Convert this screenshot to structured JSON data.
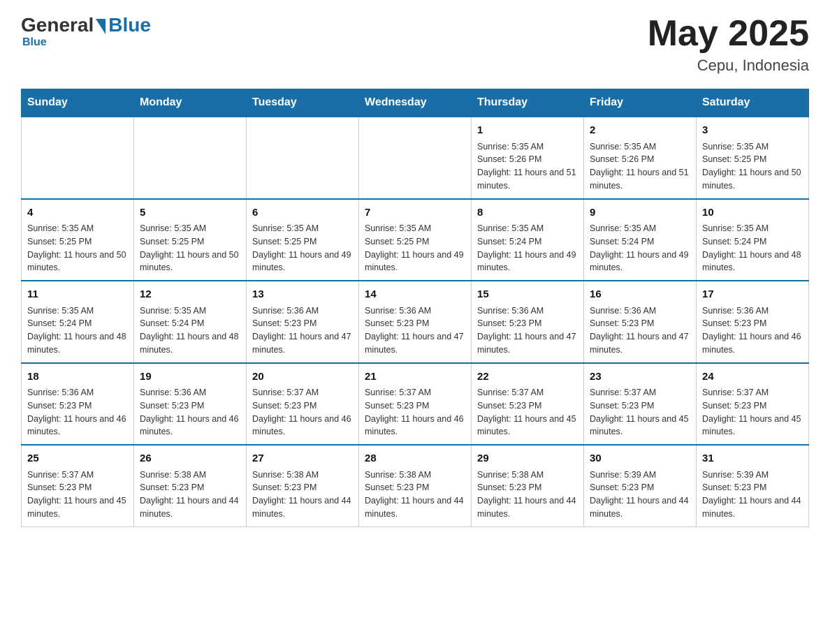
{
  "logo": {
    "general": "General",
    "blue": "Blue",
    "tagline": "Blue"
  },
  "title": {
    "month_year": "May 2025",
    "location": "Cepu, Indonesia"
  },
  "days_of_week": [
    "Sunday",
    "Monday",
    "Tuesday",
    "Wednesday",
    "Thursday",
    "Friday",
    "Saturday"
  ],
  "weeks": [
    [
      {
        "day": "",
        "sunrise": "",
        "sunset": "",
        "daylight": ""
      },
      {
        "day": "",
        "sunrise": "",
        "sunset": "",
        "daylight": ""
      },
      {
        "day": "",
        "sunrise": "",
        "sunset": "",
        "daylight": ""
      },
      {
        "day": "",
        "sunrise": "",
        "sunset": "",
        "daylight": ""
      },
      {
        "day": "1",
        "sunrise": "Sunrise: 5:35 AM",
        "sunset": "Sunset: 5:26 PM",
        "daylight": "Daylight: 11 hours and 51 minutes."
      },
      {
        "day": "2",
        "sunrise": "Sunrise: 5:35 AM",
        "sunset": "Sunset: 5:26 PM",
        "daylight": "Daylight: 11 hours and 51 minutes."
      },
      {
        "day": "3",
        "sunrise": "Sunrise: 5:35 AM",
        "sunset": "Sunset: 5:25 PM",
        "daylight": "Daylight: 11 hours and 50 minutes."
      }
    ],
    [
      {
        "day": "4",
        "sunrise": "Sunrise: 5:35 AM",
        "sunset": "Sunset: 5:25 PM",
        "daylight": "Daylight: 11 hours and 50 minutes."
      },
      {
        "day": "5",
        "sunrise": "Sunrise: 5:35 AM",
        "sunset": "Sunset: 5:25 PM",
        "daylight": "Daylight: 11 hours and 50 minutes."
      },
      {
        "day": "6",
        "sunrise": "Sunrise: 5:35 AM",
        "sunset": "Sunset: 5:25 PM",
        "daylight": "Daylight: 11 hours and 49 minutes."
      },
      {
        "day": "7",
        "sunrise": "Sunrise: 5:35 AM",
        "sunset": "Sunset: 5:25 PM",
        "daylight": "Daylight: 11 hours and 49 minutes."
      },
      {
        "day": "8",
        "sunrise": "Sunrise: 5:35 AM",
        "sunset": "Sunset: 5:24 PM",
        "daylight": "Daylight: 11 hours and 49 minutes."
      },
      {
        "day": "9",
        "sunrise": "Sunrise: 5:35 AM",
        "sunset": "Sunset: 5:24 PM",
        "daylight": "Daylight: 11 hours and 49 minutes."
      },
      {
        "day": "10",
        "sunrise": "Sunrise: 5:35 AM",
        "sunset": "Sunset: 5:24 PM",
        "daylight": "Daylight: 11 hours and 48 minutes."
      }
    ],
    [
      {
        "day": "11",
        "sunrise": "Sunrise: 5:35 AM",
        "sunset": "Sunset: 5:24 PM",
        "daylight": "Daylight: 11 hours and 48 minutes."
      },
      {
        "day": "12",
        "sunrise": "Sunrise: 5:35 AM",
        "sunset": "Sunset: 5:24 PM",
        "daylight": "Daylight: 11 hours and 48 minutes."
      },
      {
        "day": "13",
        "sunrise": "Sunrise: 5:36 AM",
        "sunset": "Sunset: 5:23 PM",
        "daylight": "Daylight: 11 hours and 47 minutes."
      },
      {
        "day": "14",
        "sunrise": "Sunrise: 5:36 AM",
        "sunset": "Sunset: 5:23 PM",
        "daylight": "Daylight: 11 hours and 47 minutes."
      },
      {
        "day": "15",
        "sunrise": "Sunrise: 5:36 AM",
        "sunset": "Sunset: 5:23 PM",
        "daylight": "Daylight: 11 hours and 47 minutes."
      },
      {
        "day": "16",
        "sunrise": "Sunrise: 5:36 AM",
        "sunset": "Sunset: 5:23 PM",
        "daylight": "Daylight: 11 hours and 47 minutes."
      },
      {
        "day": "17",
        "sunrise": "Sunrise: 5:36 AM",
        "sunset": "Sunset: 5:23 PM",
        "daylight": "Daylight: 11 hours and 46 minutes."
      }
    ],
    [
      {
        "day": "18",
        "sunrise": "Sunrise: 5:36 AM",
        "sunset": "Sunset: 5:23 PM",
        "daylight": "Daylight: 11 hours and 46 minutes."
      },
      {
        "day": "19",
        "sunrise": "Sunrise: 5:36 AM",
        "sunset": "Sunset: 5:23 PM",
        "daylight": "Daylight: 11 hours and 46 minutes."
      },
      {
        "day": "20",
        "sunrise": "Sunrise: 5:37 AM",
        "sunset": "Sunset: 5:23 PM",
        "daylight": "Daylight: 11 hours and 46 minutes."
      },
      {
        "day": "21",
        "sunrise": "Sunrise: 5:37 AM",
        "sunset": "Sunset: 5:23 PM",
        "daylight": "Daylight: 11 hours and 46 minutes."
      },
      {
        "day": "22",
        "sunrise": "Sunrise: 5:37 AM",
        "sunset": "Sunset: 5:23 PM",
        "daylight": "Daylight: 11 hours and 45 minutes."
      },
      {
        "day": "23",
        "sunrise": "Sunrise: 5:37 AM",
        "sunset": "Sunset: 5:23 PM",
        "daylight": "Daylight: 11 hours and 45 minutes."
      },
      {
        "day": "24",
        "sunrise": "Sunrise: 5:37 AM",
        "sunset": "Sunset: 5:23 PM",
        "daylight": "Daylight: 11 hours and 45 minutes."
      }
    ],
    [
      {
        "day": "25",
        "sunrise": "Sunrise: 5:37 AM",
        "sunset": "Sunset: 5:23 PM",
        "daylight": "Daylight: 11 hours and 45 minutes."
      },
      {
        "day": "26",
        "sunrise": "Sunrise: 5:38 AM",
        "sunset": "Sunset: 5:23 PM",
        "daylight": "Daylight: 11 hours and 44 minutes."
      },
      {
        "day": "27",
        "sunrise": "Sunrise: 5:38 AM",
        "sunset": "Sunset: 5:23 PM",
        "daylight": "Daylight: 11 hours and 44 minutes."
      },
      {
        "day": "28",
        "sunrise": "Sunrise: 5:38 AM",
        "sunset": "Sunset: 5:23 PM",
        "daylight": "Daylight: 11 hours and 44 minutes."
      },
      {
        "day": "29",
        "sunrise": "Sunrise: 5:38 AM",
        "sunset": "Sunset: 5:23 PM",
        "daylight": "Daylight: 11 hours and 44 minutes."
      },
      {
        "day": "30",
        "sunrise": "Sunrise: 5:39 AM",
        "sunset": "Sunset: 5:23 PM",
        "daylight": "Daylight: 11 hours and 44 minutes."
      },
      {
        "day": "31",
        "sunrise": "Sunrise: 5:39 AM",
        "sunset": "Sunset: 5:23 PM",
        "daylight": "Daylight: 11 hours and 44 minutes."
      }
    ]
  ]
}
